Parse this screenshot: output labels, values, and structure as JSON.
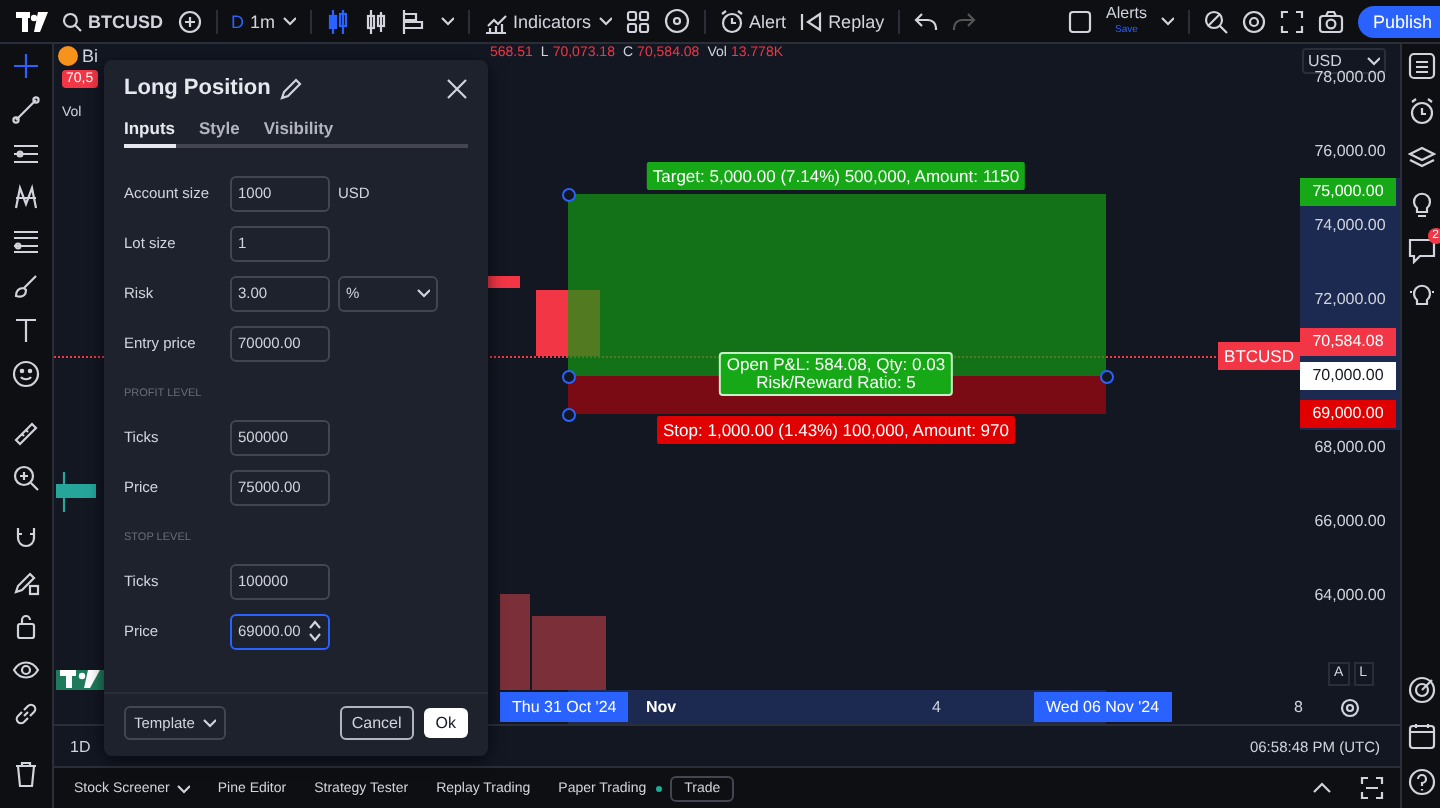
{
  "toolbar": {
    "symbol": "BTCUSD",
    "interval_prefix": "D",
    "interval": "1m",
    "indicators": "Indicators",
    "alert": "Alert",
    "replay": "Replay",
    "alerts": "Alerts",
    "alerts_sub": "Save",
    "publish": "Publish"
  },
  "legend": {
    "symbol": "Bi",
    "price_badge": "70,5",
    "volume_label": "Vol",
    "values": [
      {
        "value": "568.51"
      },
      {
        "key": "L",
        "value": "70,073.18"
      },
      {
        "key": "C",
        "value": "70,584.08"
      },
      {
        "key": "Vol",
        "value": "13.778K"
      }
    ]
  },
  "price_axis": {
    "currency": "USD",
    "ticks": [
      "78,000.00",
      "76,000.00",
      "74,000.00",
      "72,000.00",
      "68,000.00",
      "66,000.00",
      "64,000.00"
    ],
    "markers": [
      {
        "label": "75,000.00",
        "kind": "target"
      },
      {
        "label": "70,584.08",
        "kind": "last"
      },
      {
        "label": "70,000.00",
        "kind": "entry"
      },
      {
        "label": "69,000.00",
        "kind": "stop"
      }
    ],
    "symbol_tag": "BTCUSD",
    "scale_buttons": [
      "A",
      "L"
    ]
  },
  "position": {
    "target": "Target: 5,000.00 (7.14%) 500,000, Amount: 1150",
    "pnl": "Open P&L: 584.08, Qty: 0.03",
    "ratio": "Risk/Reward Ratio: 5",
    "stop": "Stop: 1,000.00 (1.43%) 100,000, Amount: 970"
  },
  "time_axis": [
    {
      "text": "Thu 31 Oct '24",
      "kind": "highlight"
    },
    {
      "text": "Nov",
      "kind": "month"
    },
    {
      "text": "4",
      "kind": "day"
    },
    {
      "text": "Wed 06 Nov '24",
      "kind": "highlight"
    },
    {
      "text": "8",
      "kind": "day"
    }
  ],
  "status": {
    "range": "1D",
    "time": "06:58:48 PM (UTC)"
  },
  "bottom_bar": {
    "items": [
      {
        "label": "Stock Screener",
        "kind": "dropdown"
      },
      {
        "label": "Pine Editor",
        "kind": "tab"
      },
      {
        "label": "Strategy Tester",
        "kind": "tab"
      },
      {
        "label": "Replay Trading",
        "kind": "tab"
      },
      {
        "label": "Paper Trading",
        "kind": "status"
      }
    ],
    "trade": "Trade"
  },
  "sidebar": {
    "chat_badge": "2"
  },
  "dialog": {
    "title": "Long Position",
    "tabs": [
      {
        "label": "Inputs",
        "selected": true
      },
      {
        "label": "Style",
        "selected": false
      },
      {
        "label": "Visibility",
        "selected": false
      }
    ],
    "rows": [
      {
        "kind": "field",
        "label": "Account size",
        "value": "1000",
        "unit": "USD",
        "focused": false
      },
      {
        "kind": "field",
        "label": "Lot size",
        "value": "1",
        "focused": false
      },
      {
        "kind": "select",
        "label": "Risk",
        "value": "3.00",
        "option": "%",
        "focused": false
      },
      {
        "kind": "field",
        "label": "Entry price",
        "value": "70000.00",
        "focused": false
      },
      {
        "kind": "section",
        "label": "PROFIT LEVEL"
      },
      {
        "kind": "field",
        "label": "Ticks",
        "value": "500000",
        "focused": false
      },
      {
        "kind": "field",
        "label": "Price",
        "value": "75000.00",
        "focused": false
      },
      {
        "kind": "section",
        "label": "STOP LEVEL"
      },
      {
        "kind": "field",
        "label": "Ticks",
        "value": "100000",
        "focused": false
      },
      {
        "kind": "field",
        "label": "Price",
        "value": "69000.00",
        "focused": true
      }
    ],
    "template": "Template",
    "cancel": "Cancel",
    "ok": "Ok"
  }
}
